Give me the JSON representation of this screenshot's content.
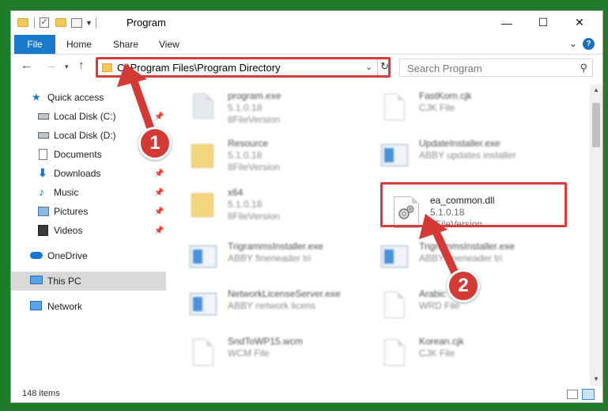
{
  "window": {
    "title": "Program",
    "controls": {
      "minimize": "—",
      "maximize": "☐",
      "close": "✕"
    }
  },
  "ribbon": {
    "tabs": [
      "File",
      "Home",
      "Share",
      "View"
    ]
  },
  "address": {
    "path": "C:\\Program Files\\Program Directory"
  },
  "search": {
    "placeholder": "Search Program"
  },
  "nav": {
    "items": [
      {
        "label": "Quick access",
        "icon": "star-icon"
      },
      {
        "label": "Local Disk (C:)",
        "icon": "drive-icon",
        "pinned": true
      },
      {
        "label": "Local Disk (D:)",
        "icon": "drive-icon"
      },
      {
        "label": "Documents",
        "icon": "documents-icon"
      },
      {
        "label": "Downloads",
        "icon": "download-icon",
        "pinned": true
      },
      {
        "label": "Music",
        "icon": "music-icon",
        "pinned": true
      },
      {
        "label": "Pictures",
        "icon": "pictures-icon",
        "pinned": true
      },
      {
        "label": "Videos",
        "icon": "videos-icon",
        "pinned": true
      },
      {
        "label": "OneDrive",
        "icon": "cloud-icon"
      },
      {
        "label": "This PC",
        "icon": "computer-icon",
        "selected": true
      },
      {
        "label": "Network",
        "icon": "network-icon"
      }
    ]
  },
  "files": [
    {
      "name": "program.exe",
      "line2": "5.1.0.18",
      "line3": "8FileVersion",
      "icon": "exe-icon"
    },
    {
      "name": "FastKorn.cjk",
      "line2": "CJK File",
      "line3": "",
      "icon": "document-icon"
    },
    {
      "name": "Resource",
      "line2": "5.1.0.18",
      "line3": "8FileVersion",
      "icon": "folder-icon"
    },
    {
      "name": "UpdateInstaller.exe",
      "line2": "ABBY updates installer",
      "line3": "",
      "icon": "installer-icon"
    },
    {
      "name": "x64",
      "line2": "5.1.0.18",
      "line3": "8FileVersion",
      "icon": "folder-icon"
    },
    {
      "name": "ea_common.dll",
      "line2": "5.1.0.18",
      "line3": "8FileVersion",
      "icon": "dll-gear-icon",
      "highlighted": true
    },
    {
      "name": "TrigrammsInstaller.exe",
      "line2": "ABBY fineneader tri",
      "line3": "",
      "icon": "installer-icon"
    },
    {
      "name": "TrigrammsInstaller.exe",
      "line2": "ABBY fineneader tri",
      "line3": "",
      "icon": "installer-icon"
    },
    {
      "name": "NetworkLicenseServer.exe",
      "line2": "ABBY network licens",
      "line3": "",
      "icon": "installer-icon"
    },
    {
      "name": "Arabic",
      "line2": "WRD File",
      "line3": "",
      "icon": "document-icon"
    },
    {
      "name": "SndToWP15.wcm",
      "line2": "WCM File",
      "line3": "",
      "icon": "document-icon"
    },
    {
      "name": "Korean.cjk",
      "line2": "CJK File",
      "line3": "",
      "icon": "document-icon"
    }
  ],
  "status": {
    "item_count": "148 items"
  },
  "annotations": {
    "badge1": "1",
    "badge2": "2",
    "color": "#d33a36"
  }
}
